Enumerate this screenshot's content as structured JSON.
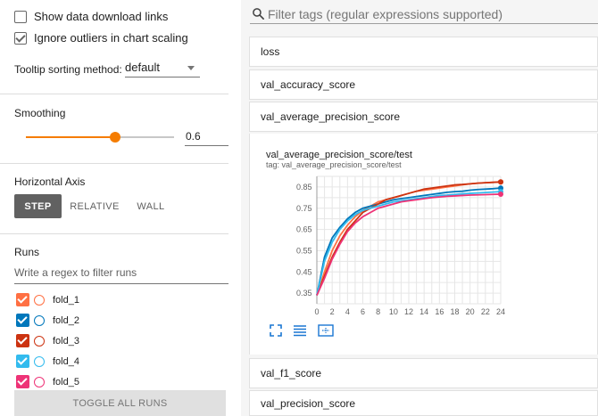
{
  "sidebar": {
    "show_download": "Show data download links",
    "ignore_outliers": "Ignore outliers in chart scaling",
    "tooltip_label": "Tooltip sorting method:",
    "tooltip_value": "default",
    "smoothing_title": "Smoothing",
    "smoothing_value": "0.6",
    "smoothing_fraction": 0.6,
    "haxis_title": "Horizontal Axis",
    "haxis_options": [
      "STEP",
      "RELATIVE",
      "WALL"
    ],
    "runs_title": "Runs",
    "runs_filter_placeholder": "Write a regex to filter runs",
    "runs": [
      {
        "name": "fold_1",
        "color": "#ff7043"
      },
      {
        "name": "fold_2",
        "color": "#0077bb"
      },
      {
        "name": "fold_3",
        "color": "#cc3311"
      },
      {
        "name": "fold_4",
        "color": "#33bbee"
      },
      {
        "name": "fold_5",
        "color": "#ee3377"
      }
    ],
    "toggle_all": "TOGGLE ALL RUNS"
  },
  "main": {
    "search_placeholder": "Filter tags (regular expressions supported)",
    "cards_top": [
      "loss",
      "val_accuracy_score",
      "val_average_precision_score"
    ],
    "cards_bottom": [
      "val_f1_score",
      "val_precision_score"
    ]
  },
  "chart_data": {
    "type": "line",
    "title": "val_average_precision_score/test",
    "subtitle": "tag: val_average_precision_score/test",
    "xlabel": "",
    "ylabel": "",
    "xlim": [
      0,
      24
    ],
    "ylim": [
      0.3,
      0.9
    ],
    "x_ticks": [
      "0",
      "2",
      "4",
      "6",
      "8",
      "10",
      "12",
      "14",
      "16",
      "18",
      "20",
      "22",
      "24"
    ],
    "y_ticks": [
      "0.35",
      "0.45",
      "0.55",
      "0.65",
      "0.75",
      "0.85"
    ],
    "grid": true,
    "x": [
      0,
      1,
      2,
      3,
      4,
      5,
      6,
      7,
      8,
      9,
      10,
      11,
      12,
      13,
      14,
      15,
      16,
      17,
      18,
      19,
      20,
      21,
      22,
      23,
      24
    ],
    "series": [
      {
        "name": "fold_1",
        "color": "#ff7043",
        "values": [
          0.34,
          0.45,
          0.55,
          0.62,
          0.67,
          0.71,
          0.74,
          0.76,
          0.78,
          0.79,
          0.8,
          0.81,
          0.82,
          0.83,
          0.835,
          0.84,
          0.845,
          0.85,
          0.855,
          0.86,
          0.865,
          0.868,
          0.87,
          0.872,
          0.874
        ]
      },
      {
        "name": "fold_2",
        "color": "#0077bb",
        "values": [
          0.34,
          0.52,
          0.61,
          0.66,
          0.7,
          0.73,
          0.75,
          0.76,
          0.77,
          0.78,
          0.79,
          0.795,
          0.8,
          0.805,
          0.81,
          0.815,
          0.82,
          0.825,
          0.828,
          0.83,
          0.835,
          0.838,
          0.84,
          0.842,
          0.845
        ]
      },
      {
        "name": "fold_3",
        "color": "#cc3311",
        "values": [
          0.34,
          0.43,
          0.52,
          0.59,
          0.65,
          0.69,
          0.73,
          0.75,
          0.77,
          0.79,
          0.8,
          0.81,
          0.82,
          0.83,
          0.84,
          0.845,
          0.85,
          0.855,
          0.86,
          0.862,
          0.865,
          0.868,
          0.87,
          0.872,
          0.874
        ]
      },
      {
        "name": "fold_4",
        "color": "#33bbee",
        "values": [
          0.34,
          0.5,
          0.59,
          0.65,
          0.69,
          0.72,
          0.74,
          0.75,
          0.76,
          0.77,
          0.78,
          0.785,
          0.79,
          0.795,
          0.8,
          0.805,
          0.81,
          0.812,
          0.815,
          0.818,
          0.82,
          0.822,
          0.824,
          0.826,
          0.828
        ]
      },
      {
        "name": "fold_5",
        "color": "#ee3377",
        "values": [
          0.34,
          0.42,
          0.51,
          0.58,
          0.64,
          0.68,
          0.71,
          0.73,
          0.75,
          0.76,
          0.77,
          0.78,
          0.785,
          0.79,
          0.795,
          0.8,
          0.803,
          0.806,
          0.808,
          0.81,
          0.812,
          0.813,
          0.814,
          0.815,
          0.816
        ]
      }
    ]
  }
}
